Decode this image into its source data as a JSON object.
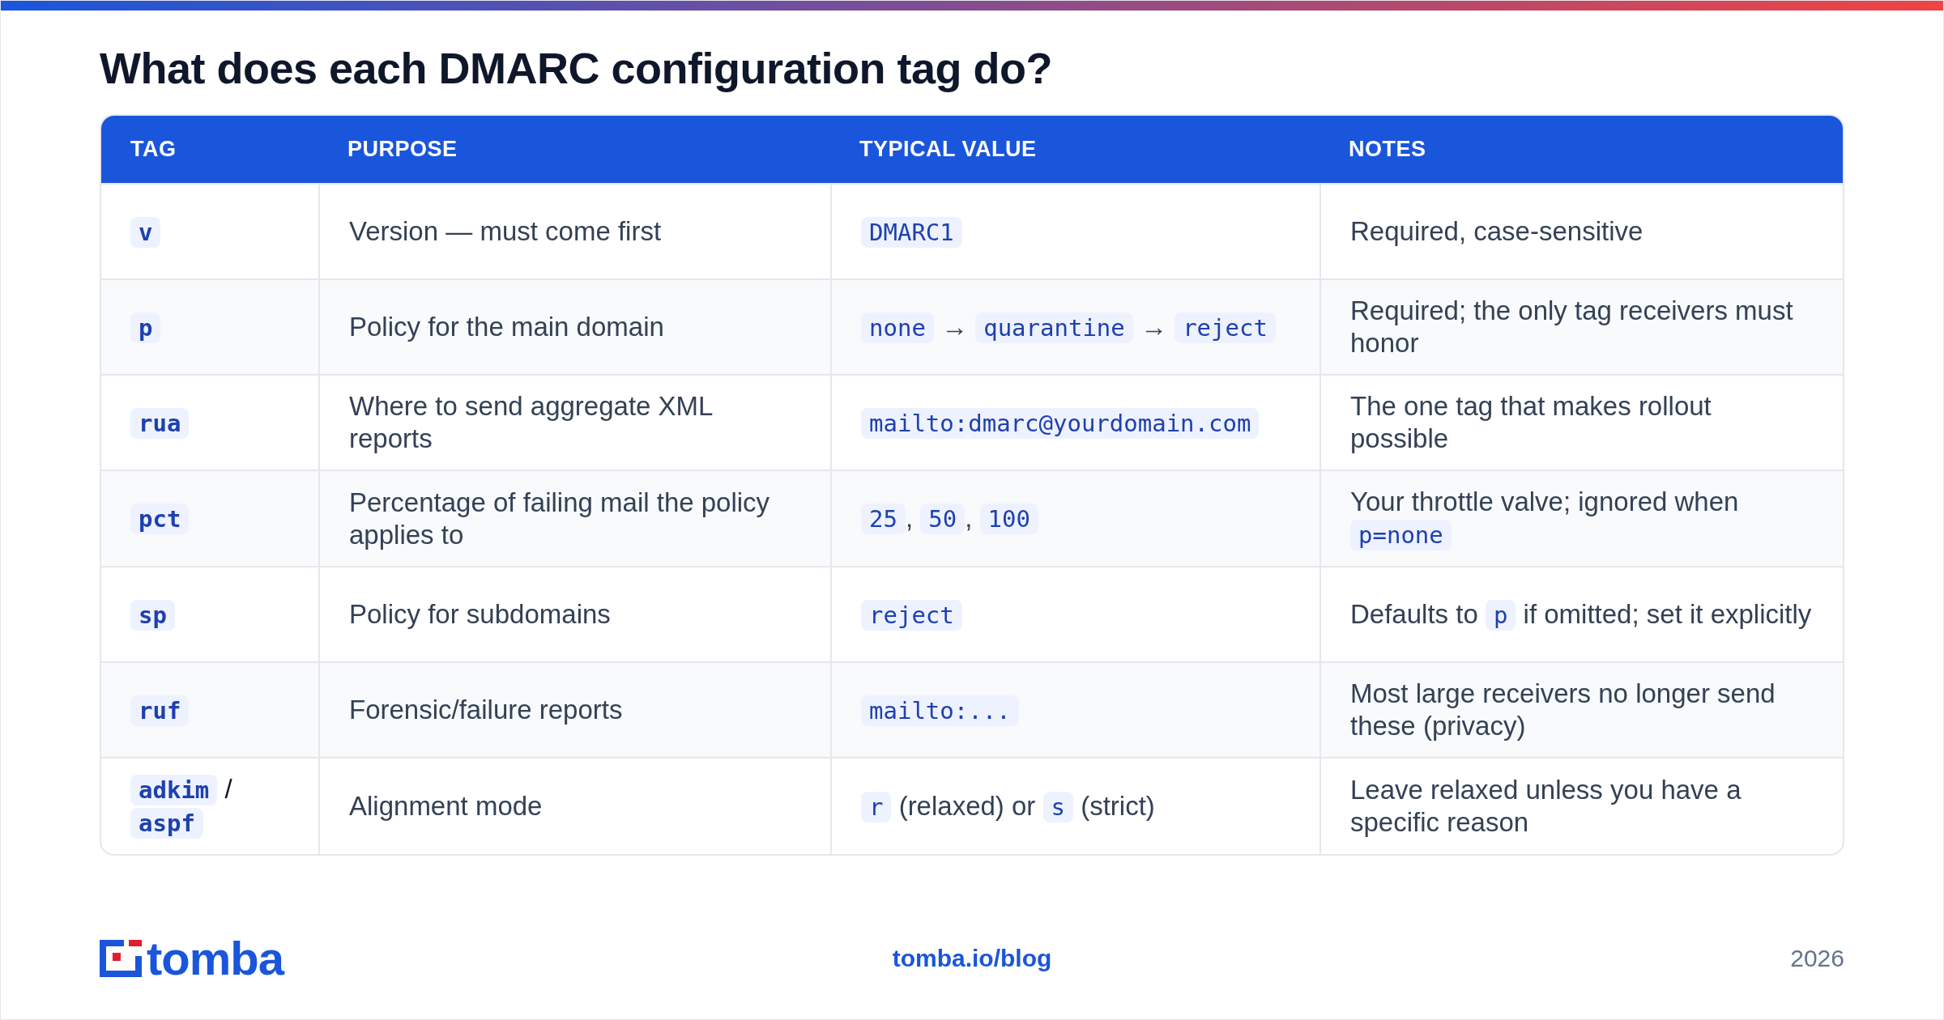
{
  "title": "What does each DMARC configuration tag do?",
  "table": {
    "columns": [
      "TAG",
      "PURPOSE",
      "TYPICAL VALUE",
      "NOTES"
    ],
    "rows": [
      {
        "cells": [
          [
            {
              "kind": "code",
              "text": "v"
            }
          ],
          [
            {
              "kind": "text",
              "text": "Version — must come first"
            }
          ],
          [
            {
              "kind": "code",
              "text": "DMARC1"
            }
          ],
          [
            {
              "kind": "text",
              "text": "Required, case-sensitive"
            }
          ]
        ]
      },
      {
        "cells": [
          [
            {
              "kind": "code",
              "text": "p"
            }
          ],
          [
            {
              "kind": "text",
              "text": "Policy for the main domain"
            }
          ],
          [
            {
              "kind": "code",
              "text": "none"
            },
            {
              "kind": "text",
              "text": " → "
            },
            {
              "kind": "code",
              "text": "quarantine"
            },
            {
              "kind": "text",
              "text": " → "
            },
            {
              "kind": "code",
              "text": "reject"
            }
          ],
          [
            {
              "kind": "text",
              "text": "Required; the only tag receivers must honor"
            }
          ]
        ]
      },
      {
        "cells": [
          [
            {
              "kind": "code",
              "text": "rua"
            }
          ],
          [
            {
              "kind": "text",
              "text": "Where to send aggregate XML reports"
            }
          ],
          [
            {
              "kind": "code",
              "text": "mailto:dmarc@yourdomain.com"
            }
          ],
          [
            {
              "kind": "text",
              "text": "The one tag that makes rollout possible"
            }
          ]
        ]
      },
      {
        "cells": [
          [
            {
              "kind": "code",
              "text": "pct"
            }
          ],
          [
            {
              "kind": "text",
              "text": "Percentage of failing mail the policy applies to"
            }
          ],
          [
            {
              "kind": "code",
              "text": "25"
            },
            {
              "kind": "text",
              "text": ", "
            },
            {
              "kind": "code",
              "text": "50"
            },
            {
              "kind": "text",
              "text": ", "
            },
            {
              "kind": "code",
              "text": "100"
            }
          ],
          [
            {
              "kind": "text",
              "text": "Your throttle valve; ignored when "
            },
            {
              "kind": "code",
              "text": "p=none"
            }
          ]
        ]
      },
      {
        "cells": [
          [
            {
              "kind": "code",
              "text": "sp"
            }
          ],
          [
            {
              "kind": "text",
              "text": "Policy for subdomains"
            }
          ],
          [
            {
              "kind": "code",
              "text": "reject"
            }
          ],
          [
            {
              "kind": "text",
              "text": "Defaults to "
            },
            {
              "kind": "code",
              "text": "p"
            },
            {
              "kind": "text",
              "text": " if omitted; set it explicitly"
            }
          ]
        ]
      },
      {
        "cells": [
          [
            {
              "kind": "code",
              "text": "ruf"
            }
          ],
          [
            {
              "kind": "text",
              "text": "Forensic/failure reports"
            }
          ],
          [
            {
              "kind": "code",
              "text": "mailto:..."
            }
          ],
          [
            {
              "kind": "text",
              "text": "Most large receivers no longer send these (privacy)"
            }
          ]
        ]
      },
      {
        "cells": [
          [
            {
              "kind": "code",
              "text": "adkim"
            },
            {
              "kind": "text",
              "text": " / "
            },
            {
              "kind": "code",
              "text": "aspf"
            }
          ],
          [
            {
              "kind": "text",
              "text": "Alignment mode"
            }
          ],
          [
            {
              "kind": "code",
              "text": "r"
            },
            {
              "kind": "text",
              "text": " (relaxed) or "
            },
            {
              "kind": "code",
              "text": "s"
            },
            {
              "kind": "text",
              "text": " (strict)"
            }
          ],
          [
            {
              "kind": "text",
              "text": "Leave relaxed unless you have a specific reason"
            }
          ]
        ]
      }
    ]
  },
  "footer": {
    "logo_text": "tomba",
    "link": "tomba.io/blog",
    "year": "2026"
  }
}
